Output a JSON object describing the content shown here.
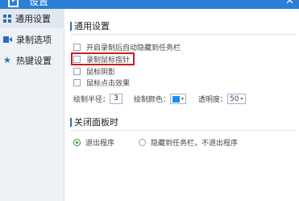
{
  "window": {
    "title": "设置",
    "close_glyph": "✕"
  },
  "sidebar": {
    "items": [
      {
        "label": "通用设置",
        "icon": "grid-icon"
      },
      {
        "label": "录制选项",
        "icon": "video-icon"
      },
      {
        "label": "热键设置",
        "icon": "star-icon"
      }
    ]
  },
  "general": {
    "section_title": "通用设置",
    "options": [
      {
        "label": "开启录制后自动隐藏到任务栏",
        "checked": false
      },
      {
        "label": "录制鼠标指针",
        "checked": false,
        "highlighted": true
      },
      {
        "label": "鼠标阴影",
        "checked": false
      },
      {
        "label": "鼠标点击效果",
        "checked": false
      }
    ],
    "radius_label": "绘制半径：",
    "radius_value": "3",
    "color_label": "绘制颜色：",
    "color_value": "#1e8cf0",
    "opacity_label": "透明度：",
    "opacity_value": "50",
    "caret_glyph": "▾"
  },
  "close_panel": {
    "section_title": "关闭面板时",
    "options": [
      {
        "label": "退出程序",
        "selected": true
      },
      {
        "label": "隐藏到任务栏，不退出程序",
        "selected": false
      }
    ]
  }
}
